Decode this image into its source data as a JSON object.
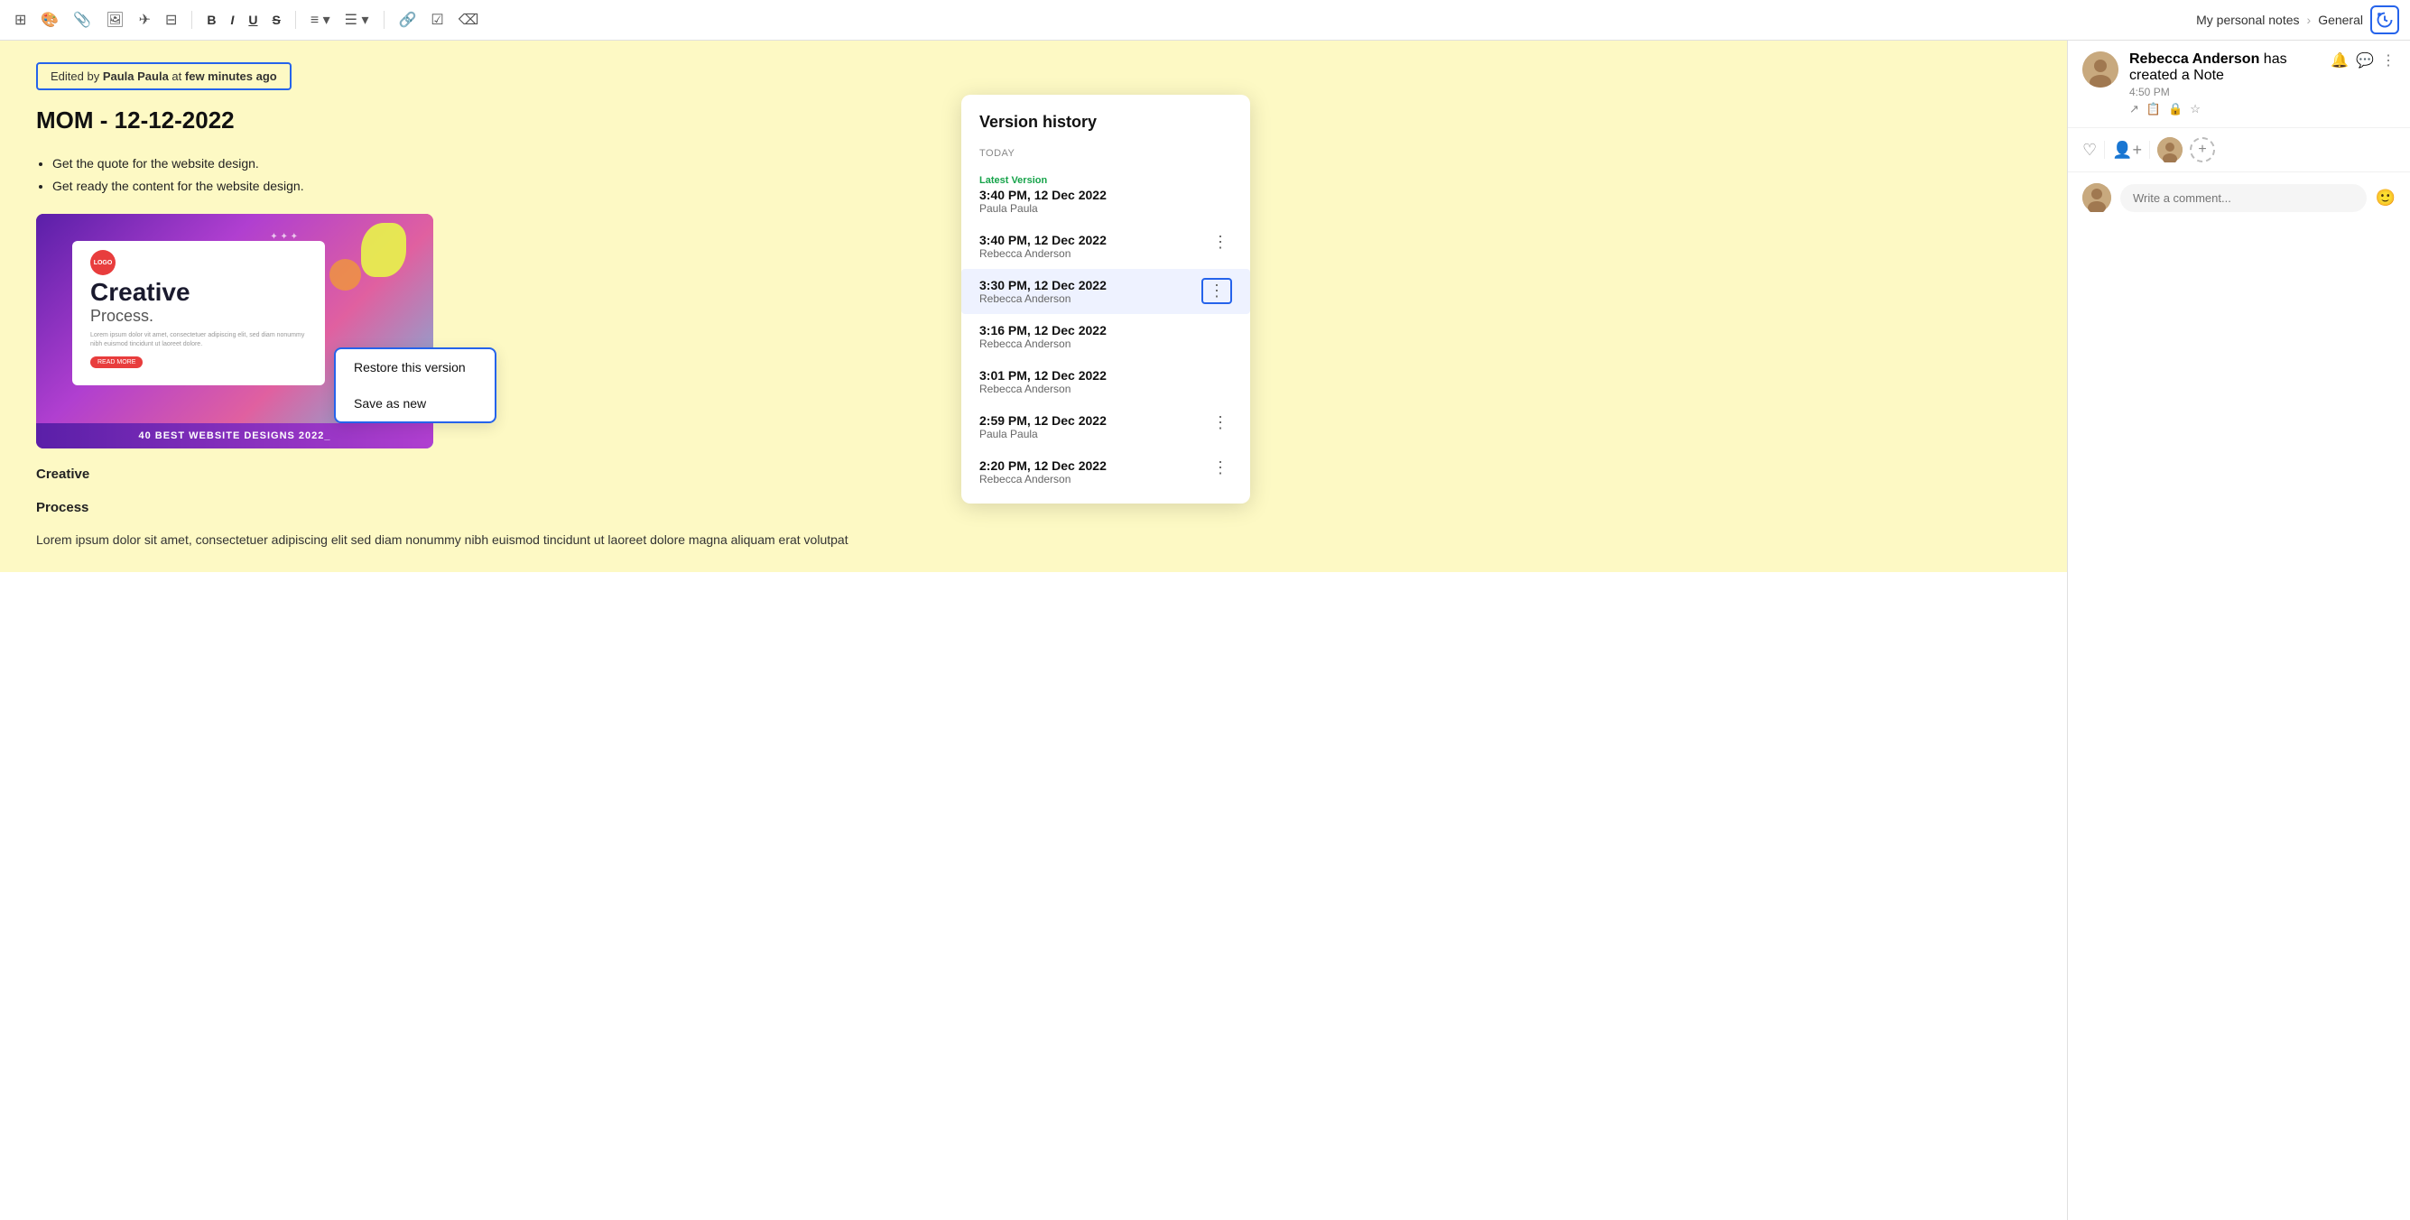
{
  "toolbar": {
    "tools": [
      {
        "name": "grid-icon",
        "symbol": "⊞"
      },
      {
        "name": "palette-icon",
        "symbol": "🎨"
      },
      {
        "name": "attach-icon",
        "symbol": "📎"
      },
      {
        "name": "image-icon",
        "symbol": "🖼"
      },
      {
        "name": "send-icon",
        "symbol": "✈"
      },
      {
        "name": "layout-icon",
        "symbol": "⊟"
      },
      {
        "name": "bold-btn",
        "symbol": "B",
        "style": "bold"
      },
      {
        "name": "italic-btn",
        "symbol": "I",
        "style": "italic"
      },
      {
        "name": "underline-btn",
        "symbol": "U",
        "style": "underline"
      },
      {
        "name": "strike-btn",
        "symbol": "S",
        "style": "strike"
      },
      {
        "name": "align-btn",
        "symbol": "≡"
      },
      {
        "name": "list-btn",
        "symbol": "☰"
      },
      {
        "name": "link-btn",
        "symbol": "🔗"
      },
      {
        "name": "check-btn",
        "symbol": "☑"
      },
      {
        "name": "erase-btn",
        "symbol": "⌫"
      }
    ],
    "breadcrumb": {
      "note": "My personal notes",
      "section": "General"
    },
    "history_button_label": "🕐"
  },
  "edited_by_banner": {
    "prefix": "Edited by ",
    "author": "Paula Paula",
    "suffix": " at ",
    "time": "few minutes ago"
  },
  "document": {
    "title": "MOM - 12-12-2022",
    "bullets": [
      "Get the quote for the website design.",
      "Get ready the content for the website design."
    ],
    "design_image": {
      "logo_text": "LOGO",
      "creative_text": "Creative",
      "process_text": "Process.",
      "lorem_text": "Lorem ipsum dolor vit amet, consectetuer adipiscing elit, sed diam nonummy nibh euismod tincidunt ut laoreet dolore.",
      "read_more": "READ MORE",
      "footer_text": "40 BEST WEBSITE DESIGNS 2022_"
    },
    "sections": [
      {
        "label": "Creative"
      },
      {
        "label": "Process"
      }
    ],
    "body_text": "Lorem ipsum dolor sit amet, consectetuer adipiscing elit sed diam nonummy nibh euismod tincidunt ut laoreet dolore magna aliquam erat volutpat"
  },
  "version_history": {
    "title": "Version history",
    "section_today": "TODAY",
    "versions": [
      {
        "id": "v1",
        "latest_label": "Latest Version",
        "time": "3:40 PM, 12 Dec 2022",
        "author": "Paula Paula",
        "is_latest": true,
        "selected": false
      },
      {
        "id": "v2",
        "time": "3:40 PM, 12 Dec 2022",
        "author": "Rebecca Anderson",
        "is_latest": false,
        "selected": false
      },
      {
        "id": "v3",
        "time": "3:30 PM, 12 Dec 2022",
        "author": "Rebecca Anderson",
        "is_latest": false,
        "selected": true
      },
      {
        "id": "v4",
        "time": "3:16 PM, 12 Dec 2022",
        "author": "Rebecca Anderson",
        "is_latest": false,
        "selected": false
      },
      {
        "id": "v5",
        "time": "3:01 PM, 12 Dec 2022",
        "author": "Rebecca Anderson",
        "is_latest": false,
        "selected": false
      },
      {
        "id": "v6",
        "time": "2:59 PM, 12 Dec 2022",
        "author": "Paula Paula",
        "is_latest": false,
        "selected": false
      },
      {
        "id": "v7",
        "time": "2:20 PM, 12 Dec 2022",
        "author": "Rebecca Anderson",
        "is_latest": false,
        "selected": false
      }
    ]
  },
  "context_menu": {
    "items": [
      {
        "label": "Restore this version",
        "name": "restore-version"
      },
      {
        "label": "Save as new",
        "name": "save-as-new"
      }
    ]
  },
  "sidebar": {
    "notification": {
      "author": "Rebecca Anderson",
      "action": " has created a Note",
      "time": "4:50 PM"
    },
    "header_icons": [
      "external-link-icon",
      "copy-icon",
      "comment-icon",
      "star-icon"
    ],
    "top_icons": [
      "bell-icon",
      "chat-icon",
      "more-options-icon"
    ],
    "comment_placeholder": "Write a comment..."
  }
}
